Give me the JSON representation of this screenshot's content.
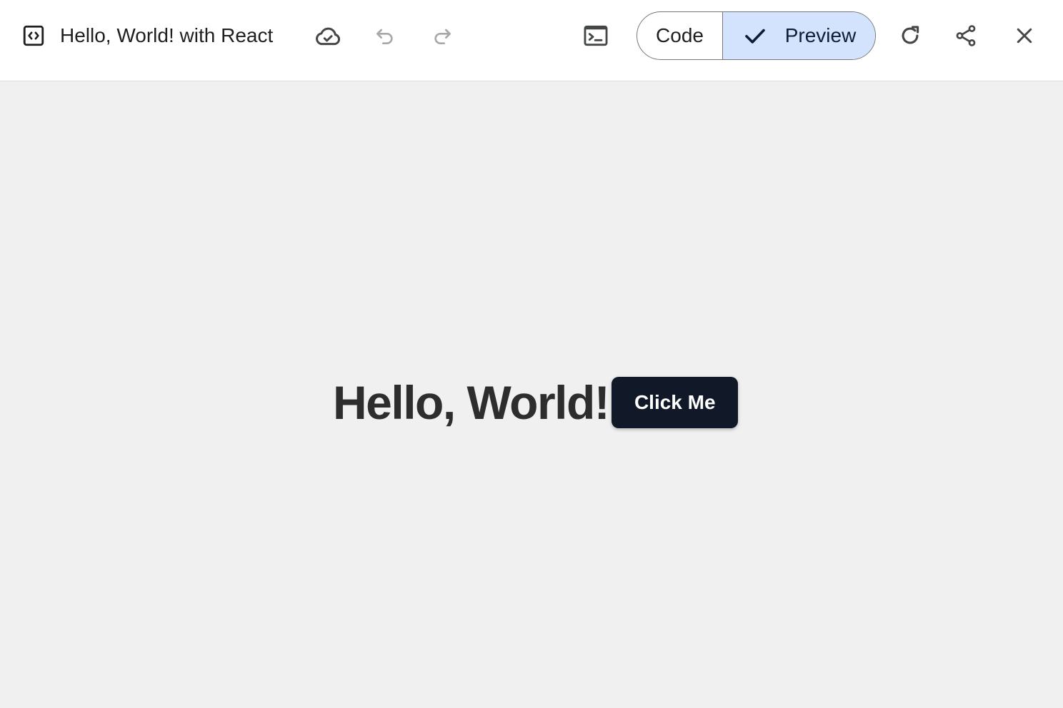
{
  "header": {
    "title": "Hello, World! with React",
    "icons": {
      "title": "code-file-icon",
      "cloud": "cloud-saved-icon",
      "undo": "undo-icon",
      "redo": "redo-icon",
      "terminal": "console-icon",
      "refresh": "refresh-icon",
      "share": "share-icon",
      "close": "close-icon"
    },
    "view_toggle": {
      "options": [
        {
          "label": "Code",
          "selected": false
        },
        {
          "label": "Preview",
          "selected": true
        }
      ]
    }
  },
  "preview": {
    "heading": "Hello, World!",
    "button_label": "Click Me"
  },
  "colors": {
    "selected_segment": "#d3e3fd",
    "button_bg": "#111827",
    "preview_bg": "#f0f0f0"
  }
}
